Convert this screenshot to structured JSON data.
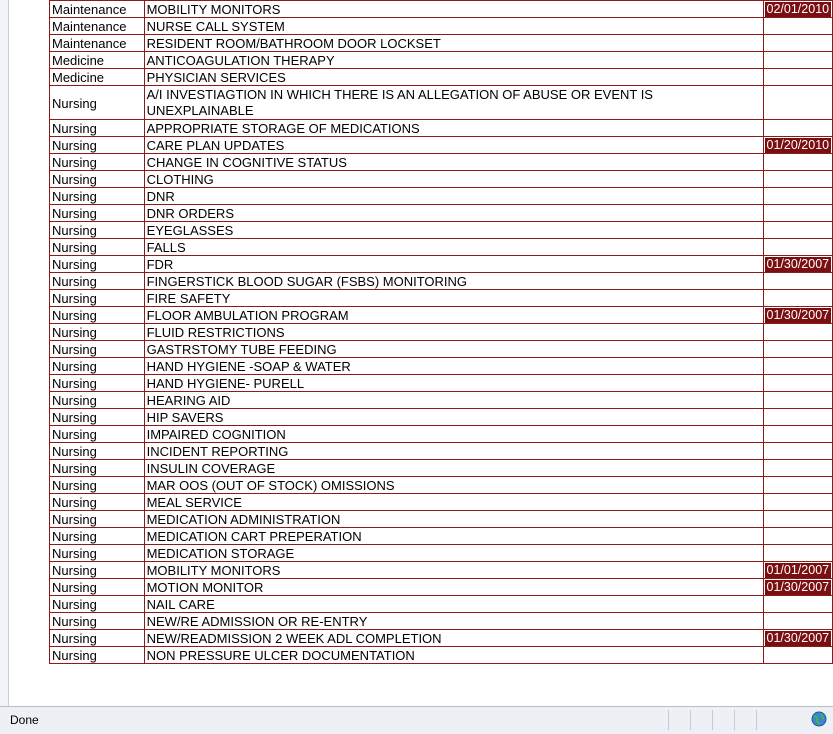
{
  "rows": [
    {
      "dept": "Maintenance",
      "topic": "MOBILITY MONITORS",
      "date": "02/01/2010"
    },
    {
      "dept": "Maintenance",
      "topic": "NURSE CALL SYSTEM",
      "date": ""
    },
    {
      "dept": "Maintenance",
      "topic": "RESIDENT ROOM/BATHROOM DOOR LOCKSET",
      "date": ""
    },
    {
      "dept": "Medicine",
      "topic": "ANTICOAGULATION THERAPY",
      "date": ""
    },
    {
      "dept": "Medicine",
      "topic": "PHYSICIAN SERVICES",
      "date": ""
    },
    {
      "dept": "Nursing",
      "topic": "A/I INVESTIAGTION IN WHICH THERE IS AN ALLEGATION OF ABUSE OR EVENT IS UNEXPLAINABLE",
      "date": "",
      "tall": true
    },
    {
      "dept": "Nursing",
      "topic": "APPROPRIATE STORAGE OF MEDICATIONS",
      "date": ""
    },
    {
      "dept": "Nursing",
      "topic": "CARE PLAN UPDATES",
      "date": "01/20/2010"
    },
    {
      "dept": "Nursing",
      "topic": "CHANGE IN COGNITIVE STATUS",
      "date": ""
    },
    {
      "dept": "Nursing",
      "topic": "CLOTHING",
      "date": ""
    },
    {
      "dept": "Nursing",
      "topic": "DNR",
      "date": ""
    },
    {
      "dept": "Nursing",
      "topic": "DNR ORDERS",
      "date": ""
    },
    {
      "dept": "Nursing",
      "topic": "EYEGLASSES",
      "date": ""
    },
    {
      "dept": "Nursing",
      "topic": "FALLS",
      "date": ""
    },
    {
      "dept": "Nursing",
      "topic": "FDR",
      "date": "01/30/2007"
    },
    {
      "dept": "Nursing",
      "topic": "FINGERSTICK BLOOD SUGAR (FSBS) MONITORING",
      "date": ""
    },
    {
      "dept": "Nursing",
      "topic": "FIRE SAFETY",
      "date": ""
    },
    {
      "dept": "Nursing",
      "topic": "FLOOR AMBULATION PROGRAM",
      "date": "01/30/2007"
    },
    {
      "dept": "Nursing",
      "topic": "FLUID RESTRICTIONS",
      "date": ""
    },
    {
      "dept": "Nursing",
      "topic": "GASTRSTOMY TUBE FEEDING",
      "date": ""
    },
    {
      "dept": "Nursing",
      "topic": "HAND HYGIENE -SOAP & WATER",
      "date": ""
    },
    {
      "dept": "Nursing",
      "topic": "HAND HYGIENE- PURELL",
      "date": ""
    },
    {
      "dept": "Nursing",
      "topic": "HEARING AID",
      "date": ""
    },
    {
      "dept": "Nursing",
      "topic": "HIP SAVERS",
      "date": ""
    },
    {
      "dept": "Nursing",
      "topic": "IMPAIRED COGNITION",
      "date": ""
    },
    {
      "dept": "Nursing",
      "topic": "INCIDENT REPORTING",
      "date": ""
    },
    {
      "dept": "Nursing",
      "topic": "INSULIN COVERAGE",
      "date": ""
    },
    {
      "dept": "Nursing",
      "topic": "MAR OOS (OUT OF STOCK) OMISSIONS",
      "date": ""
    },
    {
      "dept": "Nursing",
      "topic": "MEAL SERVICE",
      "date": ""
    },
    {
      "dept": "Nursing",
      "topic": "MEDICATION ADMINISTRATION",
      "date": ""
    },
    {
      "dept": "Nursing",
      "topic": "MEDICATION CART PREPERATION",
      "date": ""
    },
    {
      "dept": "Nursing",
      "topic": "MEDICATION STORAGE",
      "date": ""
    },
    {
      "dept": "Nursing",
      "topic": "MOBILITY MONITORS",
      "date": "01/01/2007"
    },
    {
      "dept": "Nursing",
      "topic": "MOTION MONITOR",
      "date": "01/30/2007"
    },
    {
      "dept": "Nursing",
      "topic": "NAIL CARE",
      "date": ""
    },
    {
      "dept": "Nursing",
      "topic": "NEW/RE ADMISSION OR RE-ENTRY",
      "date": ""
    },
    {
      "dept": "Nursing",
      "topic": "NEW/READMISSION 2 WEEK ADL COMPLETION",
      "date": "01/30/2007"
    },
    {
      "dept": "Nursing",
      "topic": "NON PRESSURE ULCER DOCUMENTATION",
      "date": ""
    }
  ],
  "statusbar": {
    "text": "Done",
    "icon": "globe-icon"
  },
  "colors": {
    "border": "#8b1a1a",
    "date_badge": "#7a0e10"
  }
}
